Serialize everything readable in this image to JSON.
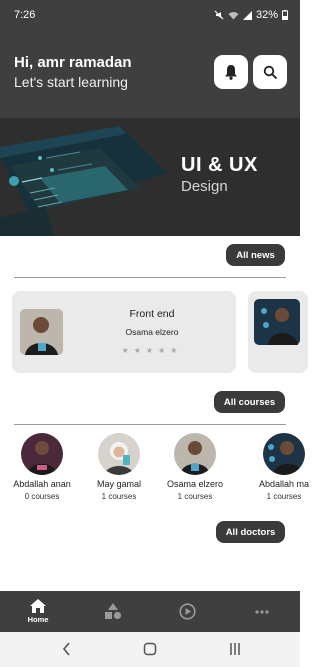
{
  "status": {
    "time": "7:26",
    "battery": "32%"
  },
  "header": {
    "greeting": "Hi, amr ramadan",
    "subtitle": "Let's start learning"
  },
  "banner": {
    "title": "UI & UX",
    "subtitle": "Design"
  },
  "news": {
    "button_label": "All news"
  },
  "courses": {
    "items": [
      {
        "title": "Front end",
        "instructor": "Osama elzero",
        "stars": "★★★★★"
      }
    ],
    "button_label": "All courses"
  },
  "doctors": {
    "items": [
      {
        "name": "Abdallah anan",
        "courses": "0 courses"
      },
      {
        "name": "May gamal",
        "courses": "1 courses"
      },
      {
        "name": "Osama elzero",
        "courses": "1 courses"
      },
      {
        "name": "Abdallah ma",
        "courses": "1 courses"
      }
    ],
    "button_label": "All doctors"
  },
  "nav": {
    "home_label": "Home"
  },
  "colors": {
    "dark": "#3f3f3f",
    "card": "#eaeaea",
    "accent": "#3a3a3a"
  }
}
